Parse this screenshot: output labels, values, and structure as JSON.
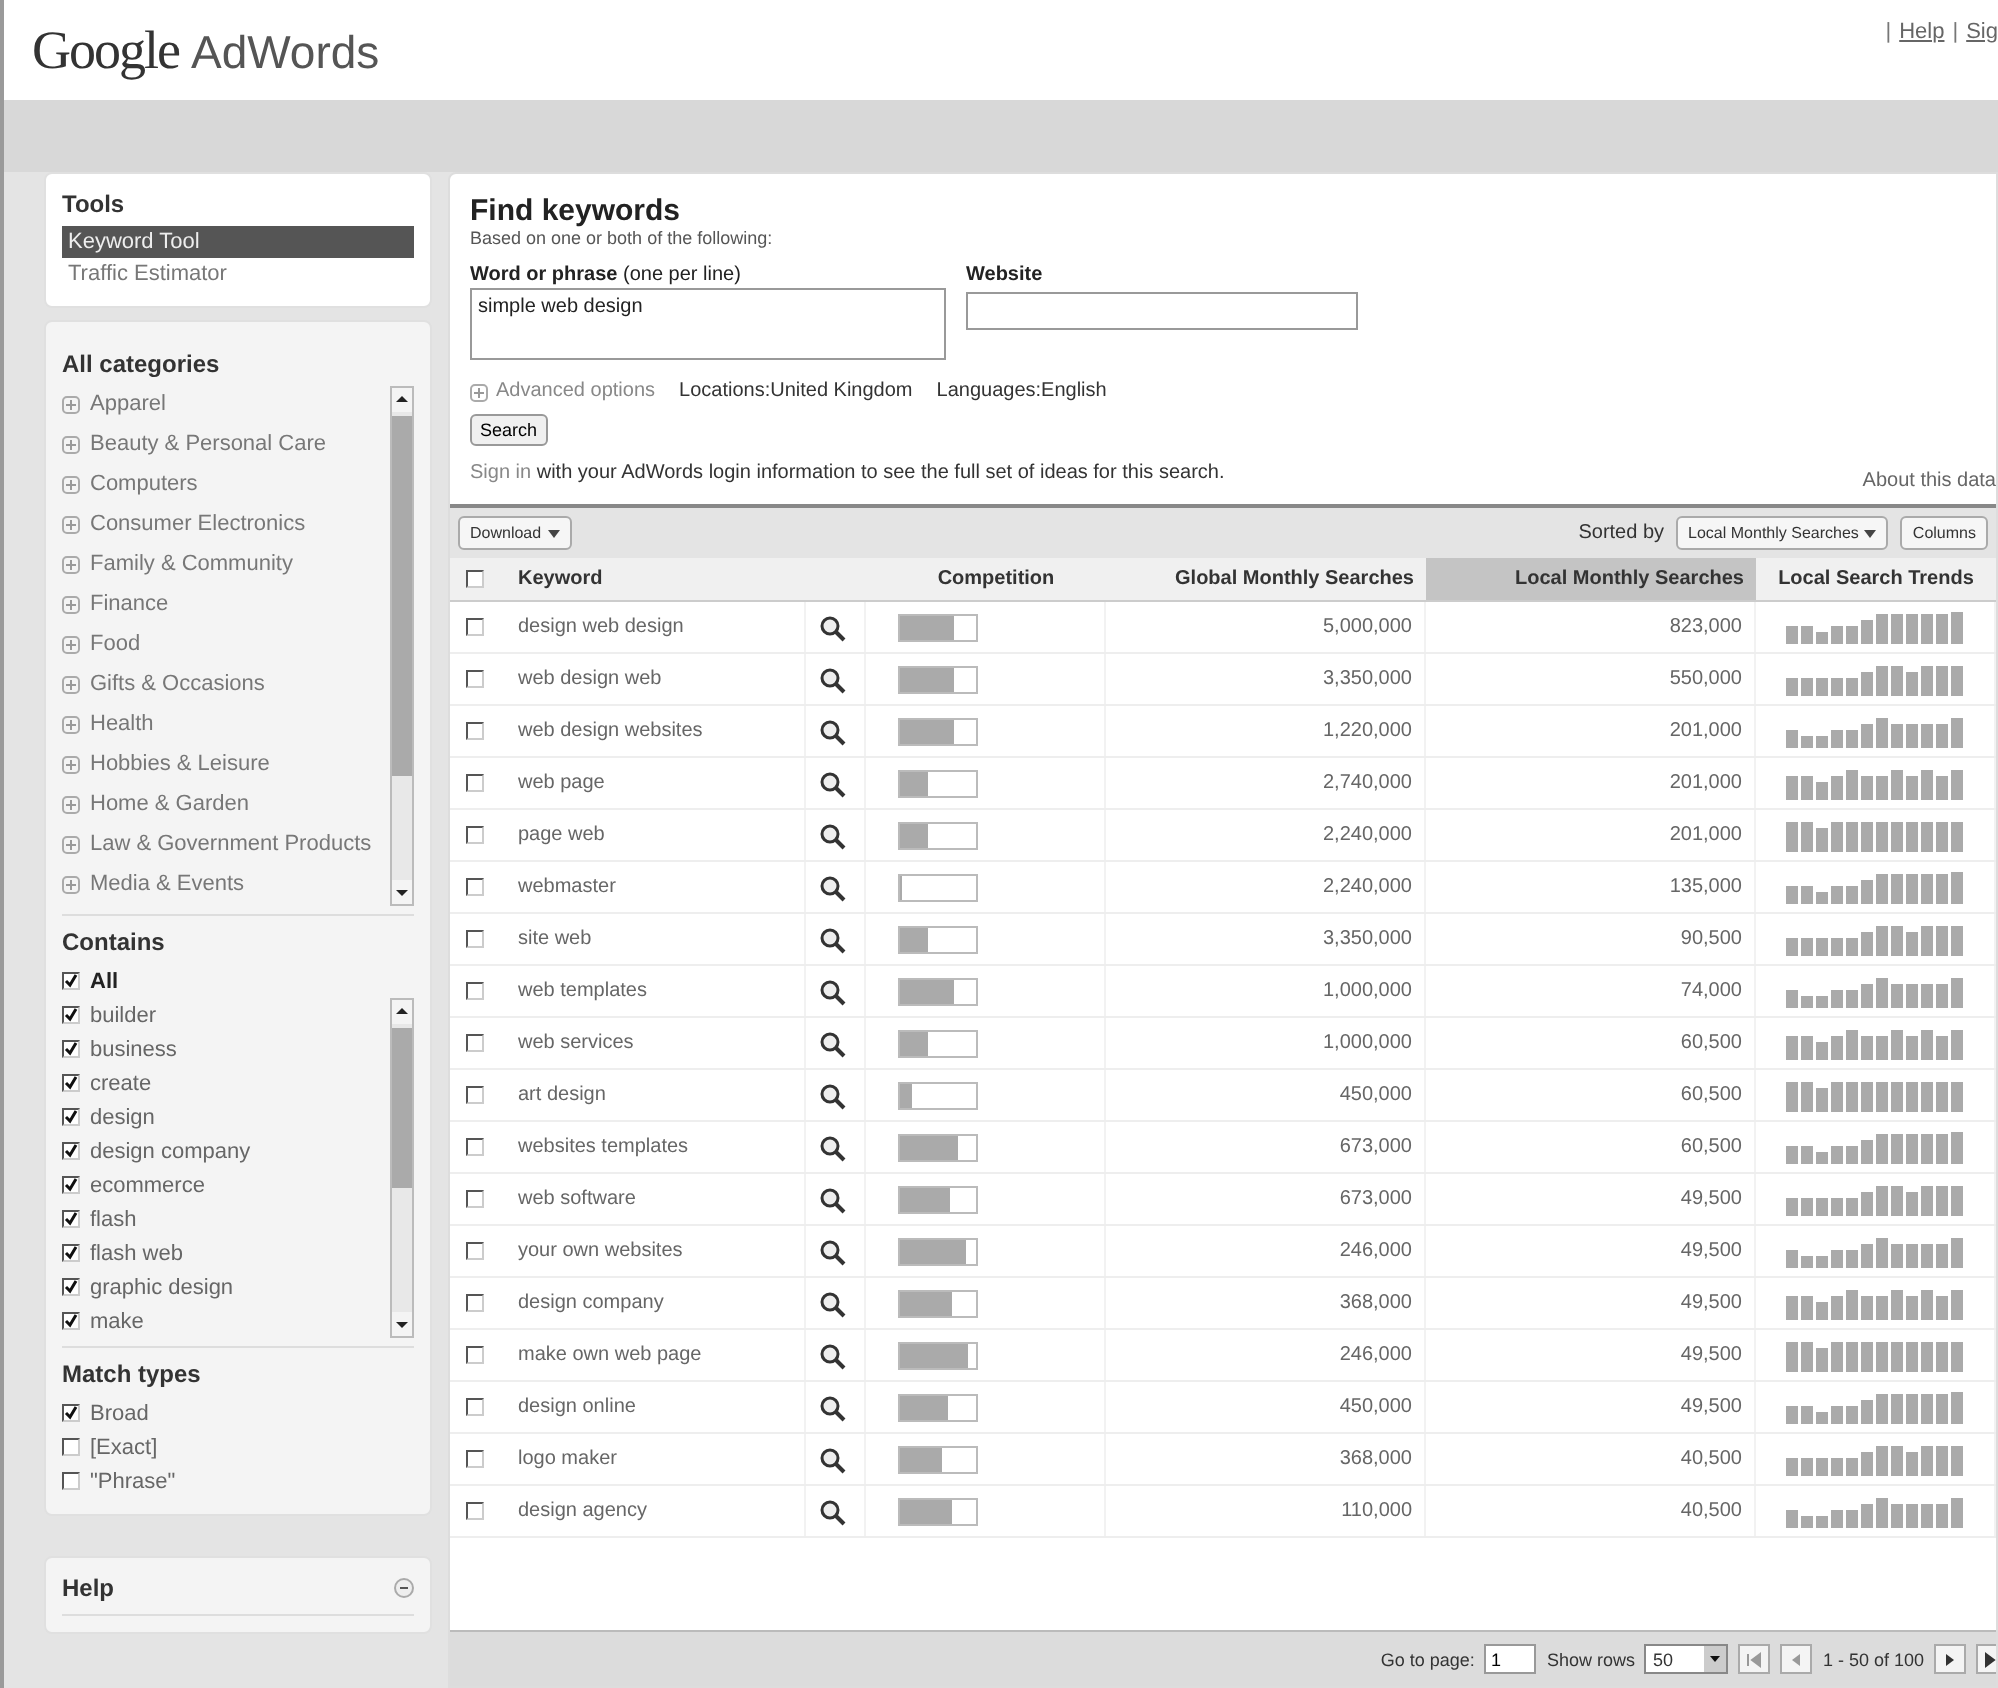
{
  "header": {
    "logo": "Google",
    "product": "AdWords",
    "separator": "|",
    "links": [
      "Help",
      "Sig"
    ]
  },
  "sidebar": {
    "tools": {
      "title": "Tools",
      "items": [
        {
          "label": "Keyword Tool",
          "selected": true
        },
        {
          "label": "Traffic Estimator",
          "selected": false
        }
      ]
    },
    "categories": {
      "title": "All categories",
      "items": [
        "Apparel",
        "Beauty & Personal Care",
        "Computers",
        "Consumer Electronics",
        "Family & Community",
        "Finance",
        "Food",
        "Gifts & Occasions",
        "Health",
        "Hobbies & Leisure",
        "Home & Garden",
        "Law & Government Products",
        "Media & Events"
      ]
    },
    "contains": {
      "title": "Contains",
      "items": [
        {
          "label": "All",
          "checked": true,
          "bold": true
        },
        {
          "label": "builder",
          "checked": true,
          "bold": false
        },
        {
          "label": "business",
          "checked": true,
          "bold": false
        },
        {
          "label": "create",
          "checked": true,
          "bold": false
        },
        {
          "label": "design",
          "checked": true,
          "bold": false
        },
        {
          "label": "design company",
          "checked": true,
          "bold": false
        },
        {
          "label": "ecommerce",
          "checked": true,
          "bold": false
        },
        {
          "label": "flash",
          "checked": true,
          "bold": false
        },
        {
          "label": "flash web",
          "checked": true,
          "bold": false
        },
        {
          "label": "graphic design",
          "checked": true,
          "bold": false
        },
        {
          "label": "make",
          "checked": true,
          "bold": false
        }
      ]
    },
    "match_types": {
      "title": "Match types",
      "items": [
        {
          "label": "Broad",
          "checked": true
        },
        {
          "label": "[Exact]",
          "checked": false
        },
        {
          "label": "\"Phrase\"",
          "checked": false
        }
      ]
    },
    "help": {
      "title": "Help",
      "expanded": true
    }
  },
  "search_form": {
    "title": "Find keywords",
    "subtitle": "Based on one or both of the following:",
    "word_label": "Word or phrase",
    "word_hint": "(one per line)",
    "word_value": "simple web design",
    "website_label": "Website",
    "advanced": "Advanced options",
    "locations": "Locations:United Kingdom",
    "languages": "Languages:English",
    "search_button": "Search",
    "sign_in_link": "Sign in",
    "sign_in_text": "with your AdWords login information to see the full set of ideas for this search.",
    "about": "About this data"
  },
  "toolbar": {
    "download": "Download",
    "sorted_by": "Sorted by",
    "sort_value": "Local Monthly Searches",
    "columns": "Columns"
  },
  "table": {
    "select_all_checked": false,
    "columns": [
      {
        "label": "Keyword",
        "selected": false
      },
      {
        "label": "Competition",
        "selected": false
      },
      {
        "label": "Global Monthly Searches",
        "selected": false
      },
      {
        "label": "Local Monthly Searches",
        "selected": true
      },
      {
        "label": "Local Search Trends",
        "selected": false
      }
    ],
    "rows": [
      {
        "keyword": "design web design",
        "checked": false,
        "level": 0.7,
        "global": "5,000,000",
        "local": "823,000"
      },
      {
        "keyword": "web design web",
        "checked": false,
        "level": 0.7,
        "global": "3,350,000",
        "local": "550,000"
      },
      {
        "keyword": "web design websites",
        "checked": false,
        "level": 0.7,
        "global": "1,220,000",
        "local": "201,000"
      },
      {
        "keyword": "web page",
        "checked": false,
        "level": 0.38,
        "global": "2,740,000",
        "local": "201,000"
      },
      {
        "keyword": "page web",
        "checked": false,
        "level": 0.38,
        "global": "2,240,000",
        "local": "201,000"
      },
      {
        "keyword": "webmaster",
        "checked": false,
        "level": 0.03,
        "global": "2,240,000",
        "local": "135,000"
      },
      {
        "keyword": "site web",
        "checked": false,
        "level": 0.38,
        "global": "3,350,000",
        "local": "90,500"
      },
      {
        "keyword": "web templates",
        "checked": false,
        "level": 0.72,
        "global": "1,000,000",
        "local": "74,000"
      },
      {
        "keyword": "web services",
        "checked": false,
        "level": 0.38,
        "global": "1,000,000",
        "local": "60,500"
      },
      {
        "keyword": "art design",
        "checked": false,
        "level": 0.15,
        "global": "450,000",
        "local": "60,500"
      },
      {
        "keyword": "websites templates",
        "checked": false,
        "level": 0.75,
        "global": "673,000",
        "local": "60,500"
      },
      {
        "keyword": "web software",
        "checked": false,
        "level": 0.65,
        "global": "673,000",
        "local": "49,500"
      },
      {
        "keyword": "your own websites",
        "checked": false,
        "level": 0.88,
        "global": "246,000",
        "local": "49,500"
      },
      {
        "keyword": "design company",
        "checked": false,
        "level": 0.68,
        "global": "368,000",
        "local": "49,500"
      },
      {
        "keyword": "make own web page",
        "checked": false,
        "level": 0.9,
        "global": "246,000",
        "local": "49,500"
      },
      {
        "keyword": "design online",
        "checked": false,
        "level": 0.62,
        "global": "450,000",
        "local": "49,500"
      },
      {
        "keyword": "logo maker",
        "checked": false,
        "level": 0.55,
        "global": "368,000",
        "local": "40,500"
      },
      {
        "keyword": "design agency",
        "checked": false,
        "level": 0.68,
        "global": "110,000",
        "local": "40,500"
      }
    ]
  },
  "pagination": {
    "go_to_label": "Go to page:",
    "page": "1",
    "rows_label": "Show rows",
    "rows_value": "50",
    "range": "1 - 50 of 100"
  }
}
